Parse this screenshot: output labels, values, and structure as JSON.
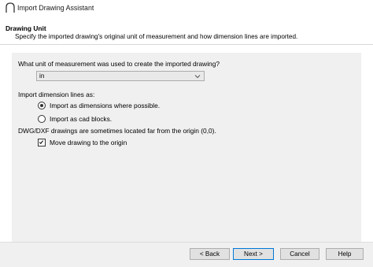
{
  "window": {
    "title": "Import Drawing Assistant",
    "icon": "arch-icon"
  },
  "header": {
    "title": "Drawing Unit",
    "description": "Specify the imported drawing's original unit of measurement and how dimension lines are imported."
  },
  "unit": {
    "question": "What unit of measurement was used to create the imported drawing?",
    "selected": "in"
  },
  "dimensions": {
    "label": "Import dimension lines as:",
    "options": [
      {
        "label": "Import as dimensions where possible.",
        "selected": true
      },
      {
        "label": "Import as cad blocks.",
        "selected": false
      }
    ]
  },
  "origin": {
    "note": "DWG/DXF drawings are sometimes located far from the origin (0,0).",
    "checkbox_label": "Move drawing to the origin",
    "checked": true
  },
  "buttons": {
    "back": "< Back",
    "next": "Next >",
    "cancel": "Cancel",
    "help": "Help"
  },
  "colors": {
    "accent": "#0078d7",
    "panel": "#f0f0f0"
  }
}
